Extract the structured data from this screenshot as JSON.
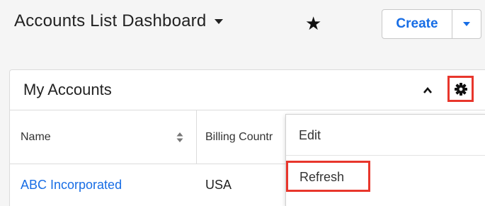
{
  "header": {
    "title": "Accounts List Dashboard",
    "title_dropdown_icon": "caret-down",
    "favorite_icon": "star",
    "create_label": "Create",
    "create_dropdown_icon": "caret-down"
  },
  "dashlet": {
    "title": "My Accounts",
    "collapse_icon": "chevron-up",
    "settings_icon": "gear",
    "columns": [
      {
        "label": "Name",
        "sortable": true
      },
      {
        "label": "Billing Countr"
      }
    ],
    "rows": [
      {
        "name": "ABC Incorporated",
        "country": "USA"
      }
    ]
  },
  "menu": {
    "items": [
      {
        "label": "Edit"
      },
      {
        "label": "Refresh",
        "highlighted": true
      }
    ]
  },
  "colors": {
    "link": "#176de5",
    "highlight": "#e8362c",
    "background": "#f5f5f5"
  }
}
